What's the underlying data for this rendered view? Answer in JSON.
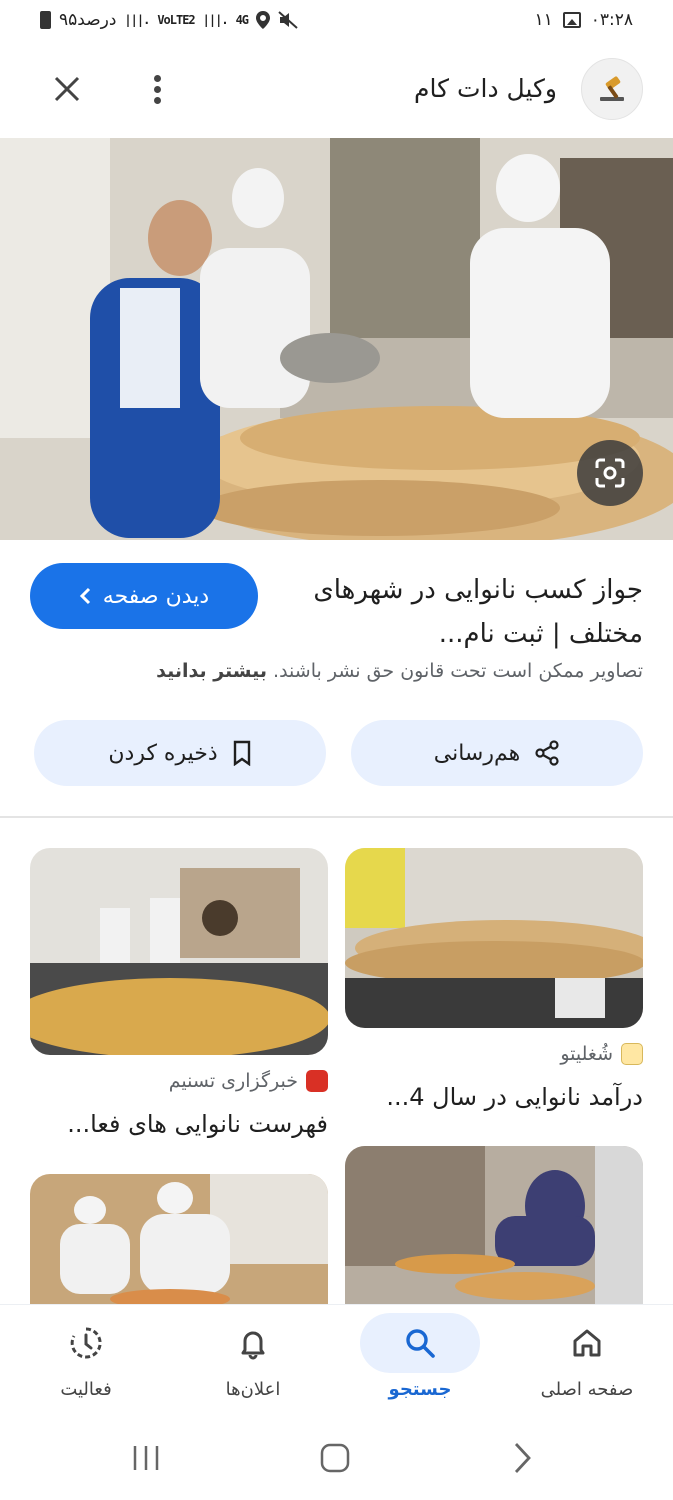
{
  "status_bar": {
    "time": "۰۳:۲۸",
    "notification_count": "۱۱",
    "battery": "۹۵درصد",
    "network_4g": "4G",
    "network_lte": "VoLTE2"
  },
  "header": {
    "site_name": "وکیل دات کام"
  },
  "result": {
    "title": "جواز کسب نانوایی در شهرهای مختلف | ثبت نام...",
    "visit_button": "دیدن صفحه",
    "copyright_text": "تصاویر ممکن است تحت قانون حق نشر باشند.",
    "learn_more": "بیشتر بدانید"
  },
  "actions": {
    "share_label": "هم‌رسانی",
    "save_label": "ذخیره کردن"
  },
  "related": [
    {
      "source": "شُغلیتو",
      "title": "درآمد نانوایی در سال 4..."
    },
    {
      "source": "خبرگزاری تسنیم",
      "title": "فهرست نانوایی های فعا..."
    }
  ],
  "bottom_nav": {
    "items": [
      {
        "label": "صفحه اصلی",
        "icon": "home-icon"
      },
      {
        "label": "جستجو",
        "icon": "search-icon"
      },
      {
        "label": "اعلان‌ها",
        "icon": "bell-icon"
      },
      {
        "label": "فعالیت",
        "icon": "activity-icon"
      }
    ],
    "active_label": "جستجو"
  },
  "colors": {
    "accent": "#1a73e8",
    "pill_bg": "#e8f0fe"
  }
}
